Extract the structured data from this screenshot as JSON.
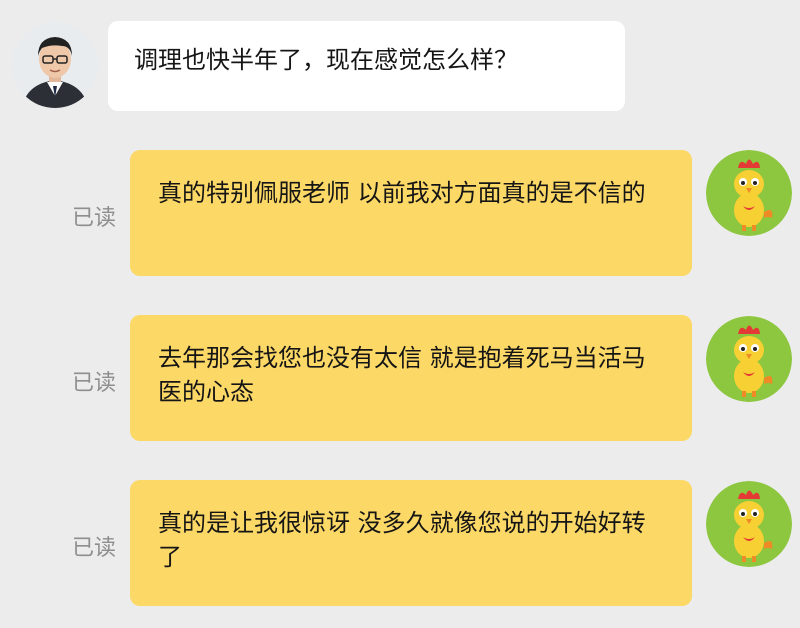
{
  "conversation": {
    "incoming": [
      {
        "text": "调理也快半年了，现在感觉怎么样？",
        "avatar_icon": "man-with-glasses-avatar"
      }
    ],
    "outgoing": [
      {
        "text": "真的特别佩服老师 以前我对方面真的是不信的",
        "status": "已读",
        "avatar_icon": "cartoon-chicken-avatar"
      },
      {
        "text": "去年那会找您也没有太信 就是抱着死马当活马医的心态",
        "status": "已读",
        "avatar_icon": "cartoon-chicken-avatar"
      },
      {
        "text": "真的是让我很惊讶 没多久就像您说的开始好转了",
        "status": "已读",
        "avatar_icon": "cartoon-chicken-avatar"
      }
    ]
  },
  "colors": {
    "background": "#ececec",
    "incoming_bubble": "#ffffff",
    "outgoing_bubble": "#fcd867",
    "read_status": "#8e8e8e",
    "chicken_avatar_bg": "#8dc63f"
  }
}
